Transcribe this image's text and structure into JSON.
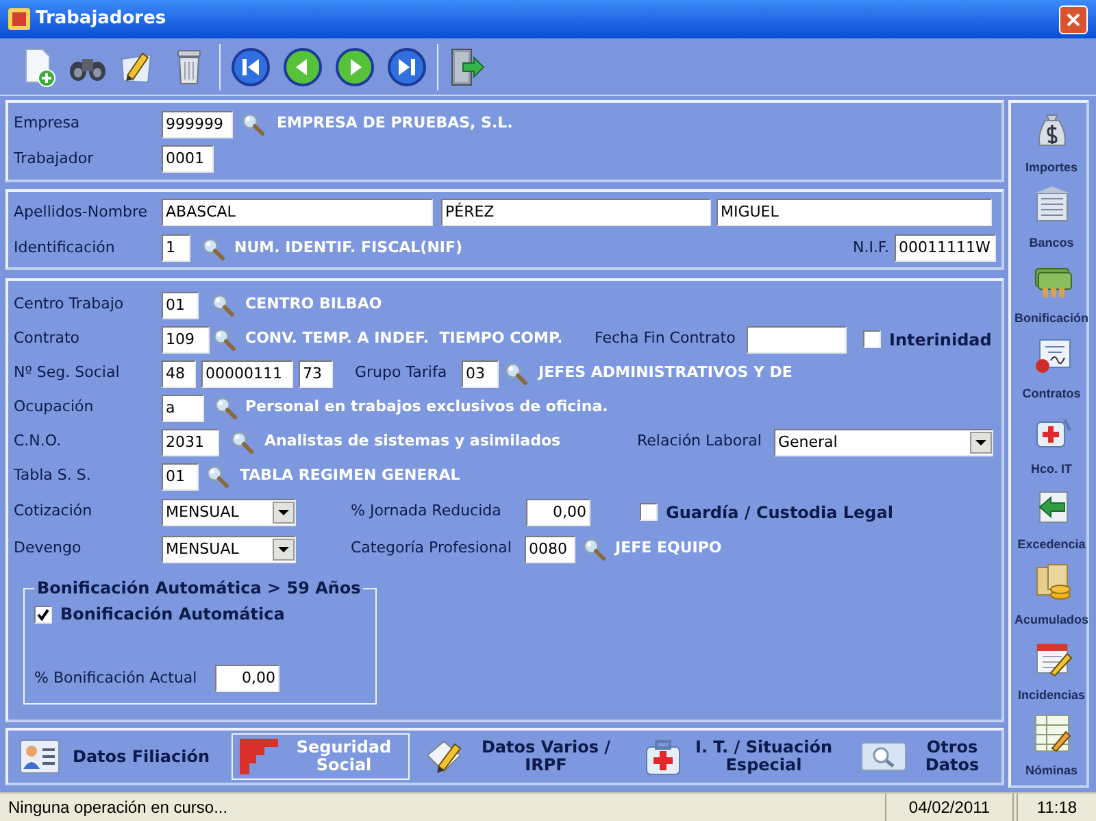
{
  "window": {
    "title": "Trabajadores"
  },
  "header": {
    "empresa": {
      "label": "Empresa",
      "code": "999999",
      "description": "EMPRESA DE PRUEBAS, S.L."
    },
    "trabajador": {
      "label": "Trabajador",
      "code": "0001"
    }
  },
  "identity": {
    "name_label": "Apellidos-Nombre",
    "names": [
      "ABASCAL",
      "PÉREZ",
      "MIGUEL"
    ],
    "id_label": "Identificación",
    "id_code": "1",
    "id_description": "NUM. IDENTIF. FISCAL(NIF)",
    "nif_label": "N.I.F.",
    "nif": "00011111W"
  },
  "employment": {
    "centro": {
      "label": "Centro Trabajo",
      "code": "01",
      "description": "CENTRO BILBAO"
    },
    "contrato": {
      "label": "Contrato",
      "code": "109",
      "description": "CONV. TEMP. A INDEF.  TIEMPO COMP.",
      "end_label": "Fecha Fin Contrato",
      "interinidad": {
        "label": "Interinidad",
        "checked": false
      }
    },
    "seg_social": {
      "label": "Nº Seg. Social",
      "parts": [
        "48",
        "00000111",
        "73"
      ],
      "grupo_label": "Grupo Tarifa",
      "grupo_code": "03",
      "grupo_description": "JEFES ADMINISTRATIVOS Y DE"
    },
    "ocupacion": {
      "label": "Ocupación",
      "code": "a",
      "description": "Personal en trabajos exclusivos de oficina."
    },
    "cno": {
      "label": "C.N.O.",
      "code": "2031",
      "description": "Analistas de sistemas y asimilados",
      "relacion_label": "Relación Laboral",
      "relacion": "General"
    },
    "tabla": {
      "label": "Tabla S. S.",
      "code": "01",
      "description": "TABLA REGIMEN GENERAL"
    },
    "cotizacion": {
      "label": "Cotización",
      "value": "MENSUAL",
      "jornada_label": "% Jornada Reducida",
      "jornada": "0,00",
      "guardia": {
        "label": "Guardía / Custodia Legal",
        "checked": false
      }
    },
    "devengo": {
      "label": "Devengo",
      "value": "MENSUAL",
      "categoria_label": "Categoría Profesional",
      "categoria_code": "0080",
      "categoria_description": "JEFE EQUIPO"
    },
    "bonificacion": {
      "title": "Bonificación Automática > 59 Años",
      "auto": {
        "label": "Bonificación Automática",
        "checked": true
      },
      "actual_label": "% Bonificación Actual",
      "actual": "0,00"
    }
  },
  "sections": [
    {
      "label": "Datos Filiación",
      "selected": false
    },
    {
      "label": "Seguridad Social",
      "selected": true
    },
    {
      "label": "Datos Varios / IRPF",
      "selected": false
    },
    {
      "label": "I. T. / Situación Especial",
      "selected": false
    },
    {
      "label": "Otros Datos",
      "selected": false
    }
  ],
  "sidebar": [
    "Importes",
    "Bancos",
    "Bonificación",
    "Contratos",
    "Hco. IT",
    "Excedencia",
    "Acumulados",
    "Incidencias",
    "Nóminas"
  ],
  "status_bar": {
    "message": "Ninguna operación en curso...",
    "date": "04/02/2011",
    "time": "11:18"
  }
}
